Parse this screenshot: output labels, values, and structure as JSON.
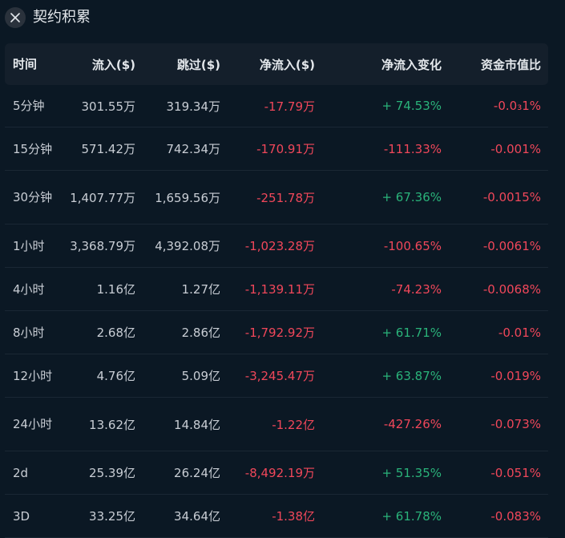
{
  "header": {
    "title": "契约积累"
  },
  "columns": [
    "时间",
    "流入($)",
    "跳过($)",
    "净流入($)",
    "净流入变化",
    "资金市值比"
  ],
  "rows": [
    {
      "time": "5分钟",
      "inflow": "301.55万",
      "skip": "319.34万",
      "net": "-17.79万",
      "change": "+ 74.53%",
      "ratio": "-0.0₃1%"
    },
    {
      "time": "15分钟",
      "inflow": "571.42万",
      "skip": "742.34万",
      "net": "-170.91万",
      "change": "-111.33%",
      "ratio": "-0.001%"
    },
    {
      "time": "30分钟",
      "inflow": "1,407.77万",
      "skip": "1,659.56万",
      "net": "-251.78万",
      "change": "+ 67.36%",
      "ratio": "-0.0015%"
    },
    {
      "time": "1小时",
      "inflow": "3,368.79万",
      "skip": "4,392.08万",
      "net": "-1,023.28万",
      "change": "-100.65%",
      "ratio": "-0.0061%"
    },
    {
      "time": "4小时",
      "inflow": "1.16亿",
      "skip": "1.27亿",
      "net": "-1,139.11万",
      "change": "-74.23%",
      "ratio": "-0.0068%"
    },
    {
      "time": "8小时",
      "inflow": "2.68亿",
      "skip": "2.86亿",
      "net": "-1,792.92万",
      "change": "+ 61.71%",
      "ratio": "-0.01%"
    },
    {
      "time": "12小时",
      "inflow": "4.76亿",
      "skip": "5.09亿",
      "net": "-3,245.47万",
      "change": "+ 63.87%",
      "ratio": "-0.019%"
    },
    {
      "time": "24小时",
      "inflow": "13.62亿",
      "skip": "14.84亿",
      "net": "-1.22亿",
      "change": "-427.26%",
      "ratio": "-0.073%"
    },
    {
      "time": "2d",
      "inflow": "25.39亿",
      "skip": "26.24亿",
      "net": "-8,492.19万",
      "change": "+ 51.35%",
      "ratio": "-0.051%"
    },
    {
      "time": "3D",
      "inflow": "33.25亿",
      "skip": "34.64亿",
      "net": "-1.38亿",
      "change": "+ 61.78%",
      "ratio": "-0.083%"
    }
  ],
  "colors": {
    "background": "#0b1824",
    "header_bg": "#141f2b",
    "positive": "#2ab37a",
    "negative": "#f0475a"
  }
}
